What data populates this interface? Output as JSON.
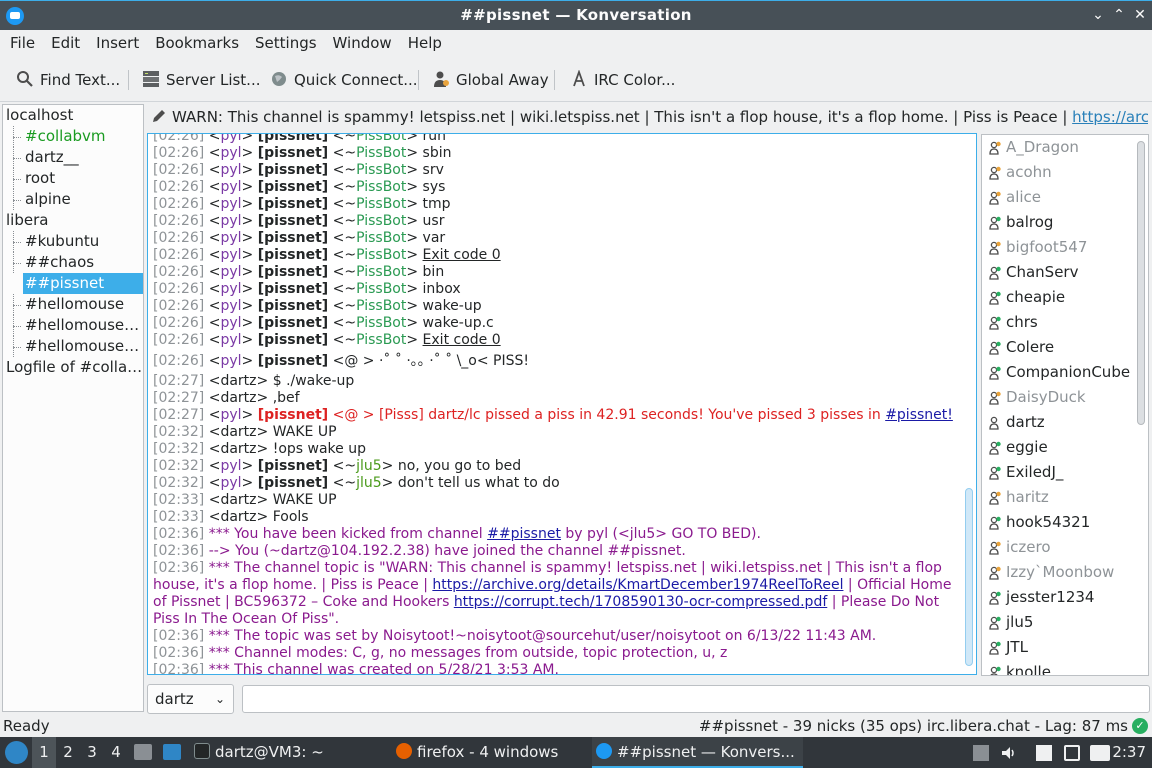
{
  "window": {
    "title": "##pissnet — Konversation"
  },
  "menu": [
    "File",
    "Edit",
    "Insert",
    "Bookmarks",
    "Settings",
    "Window",
    "Help"
  ],
  "toolbar": {
    "find": "Find Text...",
    "server_list": "Server List...",
    "quick_connect": "Quick Connect...",
    "global_away": "Global Away",
    "irc_color": "IRC Color..."
  },
  "tree": [
    {
      "label": "localhost",
      "level": 0
    },
    {
      "label": "#collabvm",
      "level": 1,
      "highlight": true
    },
    {
      "label": "dartz__",
      "level": 1
    },
    {
      "label": "root",
      "level": 1
    },
    {
      "label": "alpine",
      "level": 1
    },
    {
      "label": "libera",
      "level": 0
    },
    {
      "label": "#kubuntu",
      "level": 1
    },
    {
      "label": "##chaos",
      "level": 1
    },
    {
      "label": "##pissnet",
      "level": 1,
      "selected": true
    },
    {
      "label": "#hellomouse",
      "level": 1
    },
    {
      "label": "#hellomouse-...",
      "level": 1
    },
    {
      "label": "#hellomouse-...",
      "level": 1
    },
    {
      "label": "Logfile of #collab...",
      "level": 0
    }
  ],
  "topic": {
    "text": "WARN: This channel is spammy! letspiss.net | wiki.letspiss.net | This isn't a flop house, it's a flop home. | Piss is Peace | ",
    "link": "https://archive.org/det..."
  },
  "chat": {
    "lines": [
      {
        "kind": "bot",
        "ts": "[02:26]",
        "nick": "pyl",
        "tag": "[pissnet]",
        "bot": "PissBot",
        "msg": "run"
      },
      {
        "kind": "bot",
        "ts": "[02:26]",
        "nick": "pyl",
        "tag": "[pissnet]",
        "bot": "PissBot",
        "msg": "sbin"
      },
      {
        "kind": "bot",
        "ts": "[02:26]",
        "nick": "pyl",
        "tag": "[pissnet]",
        "bot": "PissBot",
        "msg": "srv"
      },
      {
        "kind": "bot",
        "ts": "[02:26]",
        "nick": "pyl",
        "tag": "[pissnet]",
        "bot": "PissBot",
        "msg": "sys"
      },
      {
        "kind": "bot",
        "ts": "[02:26]",
        "nick": "pyl",
        "tag": "[pissnet]",
        "bot": "PissBot",
        "msg": "tmp"
      },
      {
        "kind": "bot",
        "ts": "[02:26]",
        "nick": "pyl",
        "tag": "[pissnet]",
        "bot": "PissBot",
        "msg": "usr"
      },
      {
        "kind": "bot",
        "ts": "[02:26]",
        "nick": "pyl",
        "tag": "[pissnet]",
        "bot": "PissBot",
        "msg": "var"
      },
      {
        "kind": "bot",
        "ts": "[02:26]",
        "nick": "pyl",
        "tag": "[pissnet]",
        "bot": "PissBot",
        "msg": "Exit code 0",
        "underline": true
      },
      {
        "kind": "bot",
        "ts": "[02:26]",
        "nick": "pyl",
        "tag": "[pissnet]",
        "bot": "PissBot",
        "msg": "bin"
      },
      {
        "kind": "bot",
        "ts": "[02:26]",
        "nick": "pyl",
        "tag": "[pissnet]",
        "bot": "PissBot",
        "msg": "inbox"
      },
      {
        "kind": "bot",
        "ts": "[02:26]",
        "nick": "pyl",
        "tag": "[pissnet]",
        "bot": "PissBot",
        "msg": "wake-up"
      },
      {
        "kind": "bot",
        "ts": "[02:26]",
        "nick": "pyl",
        "tag": "[pissnet]",
        "bot": "PissBot",
        "msg": "wake-up.c"
      },
      {
        "kind": "bot",
        "ts": "[02:26]",
        "nick": "pyl",
        "tag": "[pissnet]",
        "bot": "PissBot",
        "msg": "Exit code 0",
        "underline": true
      },
      {
        "kind": "art",
        "ts": "[02:26]",
        "nick": "pyl",
        "tag": "[pissnet]",
        "msg": "<@ > ·˚ ˚ ·｡｡ ·˚ ˚ \\_o< PISS!"
      },
      {
        "kind": "plain",
        "ts": "[02:27]",
        "text": "<dartz> $ ./wake-up"
      },
      {
        "kind": "plain",
        "ts": "[02:27]",
        "text": "<dartz> ,bef"
      },
      {
        "kind": "alert",
        "ts": "[02:27]",
        "nick": "pyl",
        "tag": "[pissnet]",
        "msg": "<@ > [Pisss] dartz/lc pissed a piss in 42.91 seconds! You've pissed 3 pisses in ",
        "link": "#pissnet!"
      },
      {
        "kind": "plain",
        "ts": "[02:32]",
        "text": "<dartz> WAKE UP"
      },
      {
        "kind": "plain",
        "ts": "[02:32]",
        "text": "<dartz> !ops wake up"
      },
      {
        "kind": "relay",
        "ts": "[02:32]",
        "nick": "pyl",
        "tag": "[pissnet]",
        "who": "jlu5",
        "msg": "no, you go to bed"
      },
      {
        "kind": "relay",
        "ts": "[02:32]",
        "nick": "pyl",
        "tag": "[pissnet]",
        "who": "jlu5",
        "msg": "don't tell us what to do"
      },
      {
        "kind": "plain",
        "ts": "[02:33]",
        "text": "<dartz> WAKE UP"
      },
      {
        "kind": "plain",
        "ts": "[02:33]",
        "text": "<dartz> Fools"
      },
      {
        "kind": "sys",
        "ts": "[02:36]",
        "text": "*** You have been kicked from channel ",
        "link": "##pissnet",
        "text2": " by pyl (<jlu5> GO TO BED)."
      },
      {
        "kind": "sys",
        "ts": "[02:36]",
        "text": "--> You (~dartz@104.192.2.38) have joined the channel ##pissnet."
      },
      {
        "kind": "sys",
        "ts": "[02:36]",
        "text": "*** The channel topic is \"WARN: This channel is spammy! letspiss.net | wiki.letspiss.net | This isn't a flop house, it's a flop home. | Piss is Peace | ",
        "link": "https://archive.org/details/KmartDecember1974ReelToReel",
        "text2": " | Official Home of Pissnet | BC596372 – Coke and Hookers ",
        "link2": "https://corrupt.tech/1708590130-ocr-compressed.pdf",
        "text3": " | Please Do Not Piss In The Ocean Of Piss\"."
      },
      {
        "kind": "sys",
        "ts": "[02:36]",
        "text": "*** The topic was set by Noisytoot!~noisytoot@sourcehut/user/noisytoot on 6/13/22 11:43 AM."
      },
      {
        "kind": "sys",
        "ts": "[02:36]",
        "text": "*** Channel modes: C, g, no messages from outside, topic protection, u, z"
      },
      {
        "kind": "sys",
        "ts": "[02:36]",
        "text": "*** This channel was created on 5/28/21 3:53 AM."
      }
    ]
  },
  "nicks": [
    {
      "name": "A_Dragon",
      "away": true,
      "op": true
    },
    {
      "name": "acohn",
      "away": true,
      "op": true
    },
    {
      "name": "alice",
      "away": true,
      "op": true
    },
    {
      "name": "balrog",
      "away": false,
      "op": true
    },
    {
      "name": "bigfoot547",
      "away": true,
      "op": true
    },
    {
      "name": "ChanServ",
      "away": false,
      "op": true
    },
    {
      "name": "cheapie",
      "away": false,
      "op": true
    },
    {
      "name": "chrs",
      "away": false,
      "op": true
    },
    {
      "name": "Colere",
      "away": false,
      "op": true
    },
    {
      "name": "CompanionCube",
      "away": false,
      "op": true
    },
    {
      "name": "DaisyDuck",
      "away": true,
      "op": true
    },
    {
      "name": "dartz",
      "away": false,
      "op": false
    },
    {
      "name": "eggie",
      "away": false,
      "op": true
    },
    {
      "name": "ExiledJ_",
      "away": false,
      "op": true
    },
    {
      "name": "haritz",
      "away": true,
      "op": true
    },
    {
      "name": "hook54321",
      "away": false,
      "op": true
    },
    {
      "name": "iczero",
      "away": true,
      "op": true
    },
    {
      "name": "Izzy`Moonbow",
      "away": true,
      "op": true
    },
    {
      "name": "jesster1234",
      "away": false,
      "op": true
    },
    {
      "name": "jlu5",
      "away": false,
      "op": true
    },
    {
      "name": "JTL",
      "away": false,
      "op": true
    },
    {
      "name": "knolle",
      "away": false,
      "op": true
    }
  ],
  "input": {
    "nick": "dartz",
    "value": ""
  },
  "status": {
    "left": "Ready",
    "right": "##pissnet - 39 nicks (35 ops)  irc.libera.chat - Lag: 87 ms"
  },
  "taskbar": {
    "desktops": [
      "1",
      "2",
      "3",
      "4"
    ],
    "tasks": [
      "dartz@VM3: ~",
      "firefox - 4 windows",
      "##pissnet — Konvers..."
    ],
    "clock": "2:37"
  },
  "colors": {
    "accent": "#3daee9",
    "titlebar": "#475057",
    "taskbar": "#31363b",
    "alert": "#dd2222",
    "system": "#8a1a8e"
  }
}
